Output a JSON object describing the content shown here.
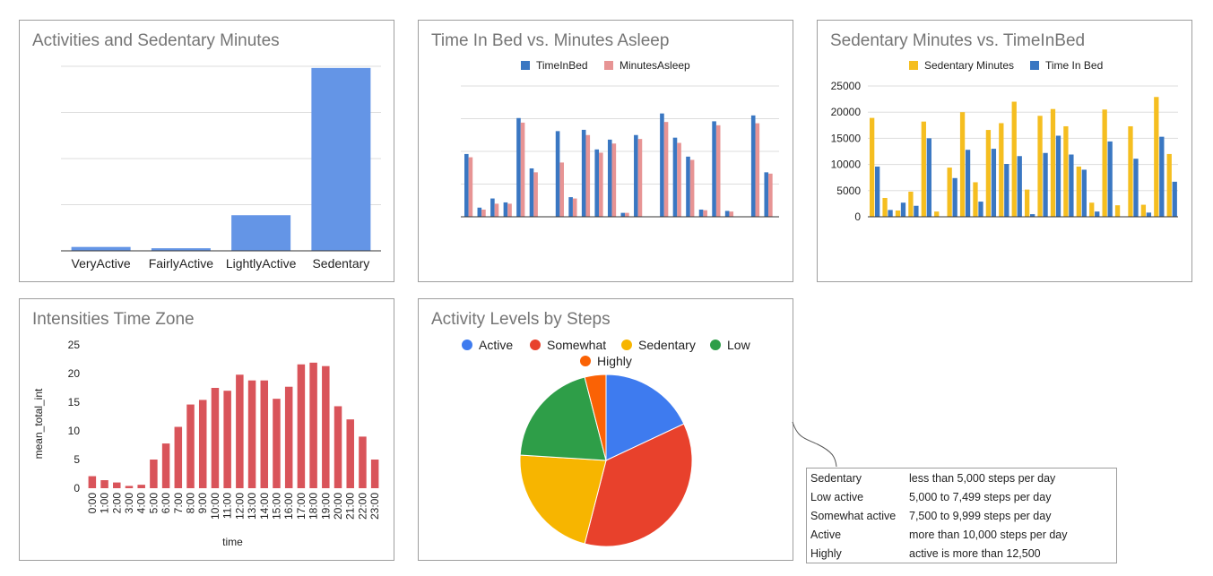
{
  "chart_data": [
    {
      "id": "activities",
      "type": "bar",
      "title": "Activities and Sedentary Minutes",
      "categories": [
        "VeryActive",
        "FairlyActive",
        "LightlyActive",
        "Sedentary"
      ],
      "values": [
        21,
        14,
        193,
        991
      ],
      "ylim": [
        0,
        1000
      ],
      "grid": true,
      "color": "#6495e6"
    },
    {
      "id": "timeinbed",
      "type": "bar",
      "title": "Time In Bed vs. Minutes Asleep",
      "legend_position": "top",
      "series": [
        {
          "name": "TimeInBed",
          "color": "#3a77c2",
          "values": [
            480,
            70,
            140,
            110,
            755,
            370,
            655,
            150,
            665,
            515,
            590,
            30,
            625,
            790,
            605,
            460,
            55,
            730,
            45,
            775,
            340
          ]
        },
        {
          "name": "MinutesAsleep",
          "color": "#e79494",
          "values": [
            455,
            55,
            100,
            100,
            720,
            340,
            415,
            140,
            625,
            490,
            560,
            30,
            595,
            725,
            565,
            435,
            50,
            700,
            40,
            715,
            330
          ]
        }
      ],
      "gaps_after": [
        5,
        12,
        18
      ],
      "ylim": [
        0,
        1000
      ],
      "grid": true
    },
    {
      "id": "sedentary_vs_bed",
      "type": "bar",
      "title": "Sedentary Minutes vs. TimeInBed",
      "legend_position": "top",
      "series": [
        {
          "name": "Sedentary Minutes",
          "color": "#f5be20",
          "values": [
            18900,
            3600,
            1200,
            4800,
            18200,
            1000,
            9400,
            20000,
            6600,
            16600,
            17900,
            22000,
            5200,
            19300,
            20600,
            17300,
            9600,
            2700,
            20500,
            2200,
            17300,
            2300,
            22900,
            12000
          ]
        },
        {
          "name": "Time In Bed",
          "color": "#3a77c2",
          "values": [
            9600,
            1300,
            2700,
            2100,
            15000,
            0,
            7400,
            12800,
            2900,
            13000,
            10100,
            11600,
            500,
            12200,
            15500,
            11900,
            9000,
            1000,
            14400,
            0,
            11100,
            800,
            15300,
            6700
          ]
        }
      ],
      "yticks": [
        0,
        5000,
        10000,
        15000,
        20000,
        25000
      ],
      "ytick_labels": [
        "0",
        "5000",
        "10000",
        "15000",
        "20000",
        "25000"
      ],
      "ylim": [
        0,
        25000
      ],
      "grid": true
    },
    {
      "id": "intensities",
      "type": "bar",
      "title": "Intensities Time Zone",
      "xlabel": "time",
      "ylabel": "mean_total_int",
      "categories": [
        "0:00",
        "1:00",
        "2:00",
        "3:00",
        "4:00",
        "5:00",
        "6:00",
        "7:00",
        "8:00",
        "9:00",
        "10:00",
        "11:00",
        "12:00",
        "13:00",
        "14:00",
        "15:00",
        "16:00",
        "17:00",
        "18:00",
        "19:00",
        "20:00",
        "21:00",
        "22:00",
        "23:00"
      ],
      "values": [
        2.1,
        1.4,
        1.0,
        0.4,
        0.6,
        5.0,
        7.8,
        10.7,
        14.6,
        15.4,
        17.5,
        17.0,
        19.8,
        18.8,
        18.8,
        15.6,
        17.7,
        21.6,
        21.9,
        21.3,
        14.3,
        12.0,
        9.0,
        5.0
      ],
      "yticks": [
        0,
        5,
        10,
        15,
        20,
        25
      ],
      "ytick_labels": [
        "0",
        "5",
        "10",
        "15",
        "20",
        "25"
      ],
      "ylim": [
        0,
        25
      ],
      "grid": false,
      "color": "#d9545a"
    },
    {
      "id": "activity_levels",
      "type": "pie",
      "title": "Activity Levels by Steps",
      "legend_position": "top",
      "labels": [
        "Active",
        "Somewhat",
        "Sedentary",
        "Low",
        "Highly"
      ],
      "values": [
        18,
        36,
        22,
        20,
        4
      ],
      "colors": [
        "#3e7bef",
        "#e8412c",
        "#f7b500",
        "#2e9e48",
        "#fa6205"
      ],
      "slice_order": [
        "Active",
        "Somewhat",
        "Sedentary",
        "Low",
        "Highly"
      ]
    }
  ],
  "steps_legend": [
    {
      "level": "Sedentary",
      "description": "less than 5,000 steps per day"
    },
    {
      "level": "Low active",
      "description": "5,000 to 7,499 steps per day"
    },
    {
      "level": "Somewhat active",
      "description": "7,500 to 9,999 steps per day"
    },
    {
      "level": "Active",
      "description": "more than 10,000 steps per day"
    },
    {
      "level": "Highly",
      "description": "active is more than 12,500"
    }
  ]
}
